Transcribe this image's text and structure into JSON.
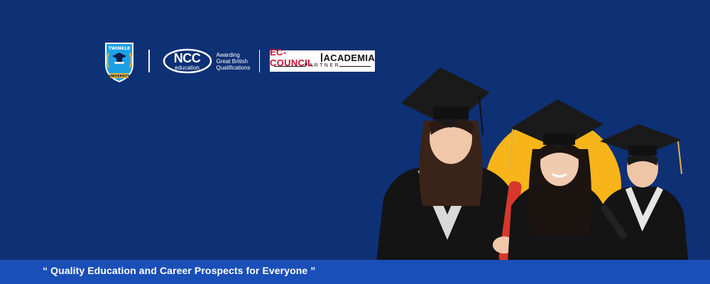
{
  "banner": {
    "tagline": "“ Quality Education and Career Prospects for Everyone ”",
    "colors": {
      "background": "#0e3075",
      "strip": "#1a4fb8",
      "accent": "#f7b519"
    }
  },
  "logos": {
    "twinkle": {
      "top_text": "TWINKLE",
      "bottom_text": "UNIVERSITY",
      "icon": "graduation-shield-icon"
    },
    "ncc": {
      "name": "NCC",
      "sub": "education",
      "lines": [
        "Awarding",
        "Great British",
        "Qualifications"
      ]
    },
    "ec_council": {
      "left": "EC-COUNCIL",
      "right": "ACADEMIA",
      "partner": "PARTNER"
    }
  }
}
